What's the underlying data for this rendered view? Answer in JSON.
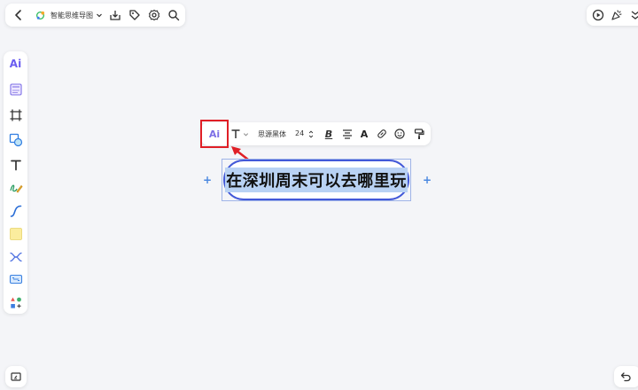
{
  "topbar": {
    "title": "智能思维导图",
    "icons": [
      "back-icon",
      "cloud-sync-icon",
      "dropdown-icon",
      "download-icon",
      "tag-icon",
      "settings-icon",
      "search-icon"
    ]
  },
  "topright": {
    "icons": [
      "play-icon",
      "celebrate-icon",
      "collapse-icon"
    ]
  },
  "sidebar": {
    "items": [
      "ai-icon",
      "template-icon",
      "frame-icon",
      "shape-icon",
      "text-icon",
      "pen-icon",
      "connector-icon",
      "sticky-note-icon",
      "mindmap-icon",
      "embed-icon",
      "more-icon"
    ],
    "ai_label": "Ai"
  },
  "toolbar": {
    "ai_label": "Ai",
    "font_family": "思源黑体",
    "font_size": "24",
    "bold_label": "B",
    "text_color_label": "A"
  },
  "node": {
    "text": "在深圳周末可以去哪里玩"
  },
  "bottom": {
    "icons": [
      "minimap-icon",
      "undo-icon"
    ]
  },
  "colors": {
    "accent": "#4258d8",
    "highlight": "#e01f26",
    "selection": "#b9d2f4"
  }
}
